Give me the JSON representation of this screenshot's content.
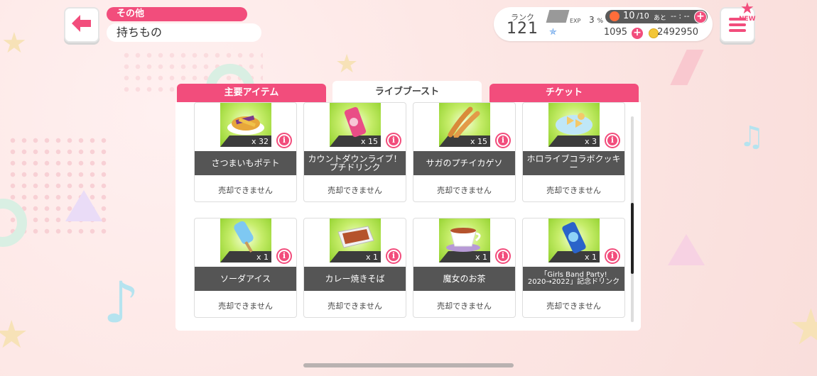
{
  "header": {
    "category": "その他",
    "title": "持ちもの"
  },
  "status": {
    "rank_label": "ランク",
    "rank_value": "121",
    "exp_label": "EXP",
    "exp_percent": "3",
    "exp_unit": "%",
    "stamina_current": "10",
    "stamina_max": "/10",
    "stamina_remaining_label": "あと",
    "stamina_timer": "-- : --",
    "stars": "1095",
    "coins": "2492950"
  },
  "menu": {
    "new_badge": "NEW"
  },
  "tabs": [
    {
      "label": "主要アイテム",
      "active": false
    },
    {
      "label": "ライブブースト",
      "active": true
    },
    {
      "label": "チケット",
      "active": false
    }
  ],
  "items": [
    {
      "name": "さつまいもポテト",
      "qty": "x 32",
      "note": "売却できません",
      "icon": "sweet-potato-fries-icon"
    },
    {
      "name": "カウントダウンライブ！プチドリンク",
      "qty": "x 15",
      "note": "売却できません",
      "icon": "drink-can-icon"
    },
    {
      "name": "サガのプチイカゲソ",
      "qty": "x 15",
      "note": "売却できません",
      "icon": "squid-tentacle-icon"
    },
    {
      "name": "ホロライブコラボクッキー",
      "qty": "x 3",
      "note": "売却できません",
      "icon": "cookie-plate-icon"
    },
    {
      "name": "ソーダアイス",
      "qty": "x 1",
      "note": "売却できません",
      "icon": "soda-ice-bar-icon"
    },
    {
      "name": "カレー焼きそば",
      "qty": "x 1",
      "note": "売却できません",
      "icon": "curry-yakisoba-icon"
    },
    {
      "name": "魔女のお茶",
      "qty": "x 1",
      "note": "売却できません",
      "icon": "tea-cup-icon"
    },
    {
      "name": "「Girls Band Party! 2020→2022」記念ドリンク",
      "qty": "x 1",
      "note": "売却できません",
      "icon": "commemorative-drink-can-icon"
    }
  ],
  "colors": {
    "accent": "#f24d7c",
    "item_bg": "#8fd02a",
    "name_bar": "#555555"
  }
}
